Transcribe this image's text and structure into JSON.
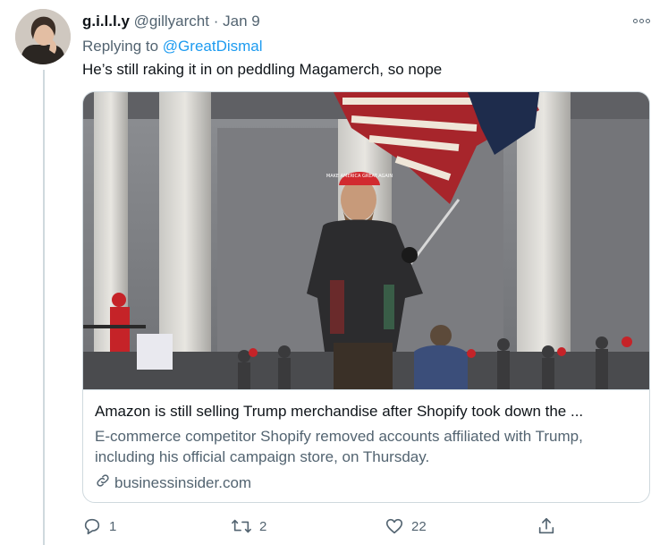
{
  "tweet": {
    "display_name": "g.i.l.l.y",
    "handle": "@gillyarcht",
    "separator": "·",
    "date": "Jan 9",
    "replying_prefix": "Replying to",
    "replying_to": "@GreatDismal",
    "text": "He’s still raking it in on peddling Magamerch, so nope"
  },
  "card": {
    "title": "Amazon is still selling Trump merchandise after Shopify took down the ...",
    "description": "E-commerce competitor Shopify removed accounts affiliated with Trump, including his official campaign store, on Thursday.",
    "domain": "businessinsider.com",
    "image_text": "MAKE AMERICA GREAT AGAIN"
  },
  "actions": {
    "reply_count": "1",
    "retweet_count": "2",
    "like_count": "22"
  },
  "colors": {
    "accent": "#1d9bf0",
    "secondary_text": "#536471",
    "border": "#cfd9de"
  }
}
